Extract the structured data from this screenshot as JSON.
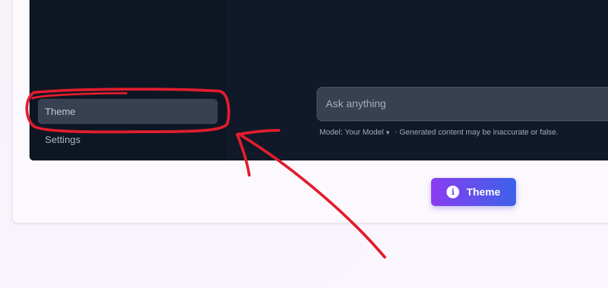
{
  "sidebar": {
    "items": [
      {
        "label": "Theme",
        "active": true
      },
      {
        "label": "Settings",
        "active": false
      }
    ]
  },
  "chat": {
    "placeholder": "Ask anything",
    "model_prefix": "Model:",
    "model_name": "Your Model",
    "disclaimer": "· Generated content may be inaccurate or false."
  },
  "theme_button": {
    "label": "Theme",
    "icon": "info-icon"
  },
  "colors": {
    "app_background": "#111827",
    "sidebar_background": "#0f1623",
    "active_item": "#374151",
    "annotation": "#e11d2e",
    "button_gradient_start": "#8a3df0",
    "button_gradient_end": "#3c62ea"
  }
}
